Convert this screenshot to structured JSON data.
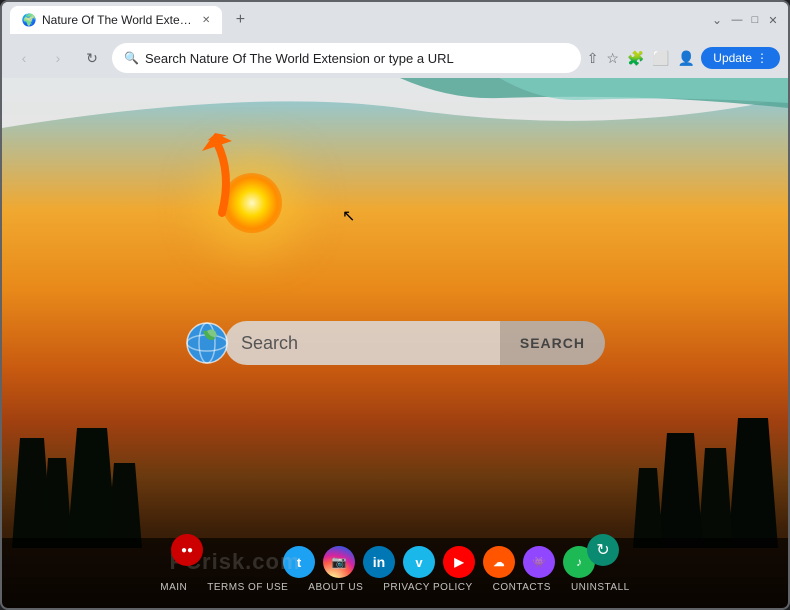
{
  "browser": {
    "tab": {
      "title": "Nature Of The World Extension",
      "favicon": "🌍"
    },
    "address": "Search Nature Of The World Extension or type a URL",
    "update_label": "Update",
    "controls": {
      "back": "‹",
      "forward": "›",
      "reload": "↻",
      "minimize": "—",
      "maximize": "□",
      "close": "✕",
      "chevron": "⌄",
      "new_tab": "+"
    }
  },
  "page": {
    "logo_emoji": "🌍",
    "search_placeholder": "Search",
    "search_button_label": "SEARCH",
    "watermark": "PCrisk.com"
  },
  "bottom_bar": {
    "social_icons": [
      {
        "name": "twitter",
        "bg": "#1DA1F2",
        "label": "t"
      },
      {
        "name": "instagram",
        "bg": "radial-gradient(circle at 30% 107%, #fdf497 0%, #fdf497 5%, #fd5949 45%,#d6249f 60%,#285AEB 90%)",
        "label": "📷"
      },
      {
        "name": "linkedin",
        "bg": "#0077B5",
        "label": "in"
      },
      {
        "name": "vimeo",
        "bg": "#1AB7EA",
        "label": "v"
      },
      {
        "name": "youtube",
        "bg": "#FF0000",
        "label": "▶"
      },
      {
        "name": "soundcloud",
        "bg": "#FF5500",
        "label": "☁"
      },
      {
        "name": "twitch",
        "bg": "#9146FF",
        "label": "👾"
      },
      {
        "name": "spotify",
        "bg": "#1DB954",
        "label": "♪"
      }
    ],
    "nav_links": [
      {
        "label": "MAIN"
      },
      {
        "label": "TERMS OF USE"
      },
      {
        "label": "ABOUT US"
      },
      {
        "label": "PRIVACY POLICY"
      },
      {
        "label": "CONTACTS"
      },
      {
        "label": "UNINSTALL"
      }
    ]
  }
}
